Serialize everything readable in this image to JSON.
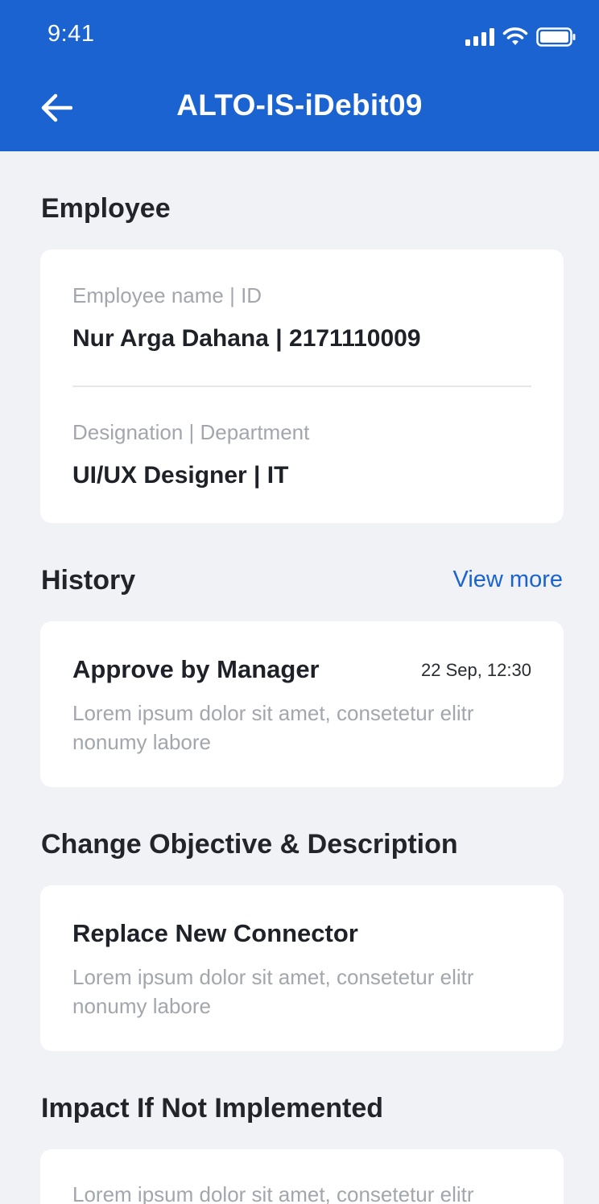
{
  "status_bar": {
    "time": "9:41",
    "icons": [
      "signal-icon",
      "wifi-icon",
      "battery-icon"
    ]
  },
  "app_bar": {
    "back_icon": "arrow-left-icon",
    "title": "ALTO-IS-iDebit09"
  },
  "employee": {
    "section_title": "Employee",
    "name_id_label": "Employee name  |  ID",
    "name_id_value": "Nur Arga Dahana  |  2171110009",
    "designation_label": "Designation  |  Department",
    "designation_value": "UI/UX Designer  |  IT"
  },
  "history": {
    "section_title": "History",
    "view_more": "View more",
    "items": [
      {
        "title": "Approve by Manager",
        "time": "22 Sep, 12:30",
        "description": "Lorem ipsum dolor sit amet, consetetur elitr nonumy labore"
      }
    ]
  },
  "change_objective": {
    "section_title": "Change Objective & Description",
    "title": "Replace New Connector",
    "description": "Lorem ipsum dolor sit amet, consetetur elitr nonumy labore"
  },
  "impact": {
    "section_title": "Impact If Not Implemented",
    "description": "Lorem ipsum dolor sit amet, consetetur elitr"
  },
  "colors": {
    "primary": "#1a63d1",
    "background": "#f1f2f6",
    "card": "#ffffff",
    "muted_text": "#a3a6ad",
    "dark_text": "#1f2128"
  }
}
